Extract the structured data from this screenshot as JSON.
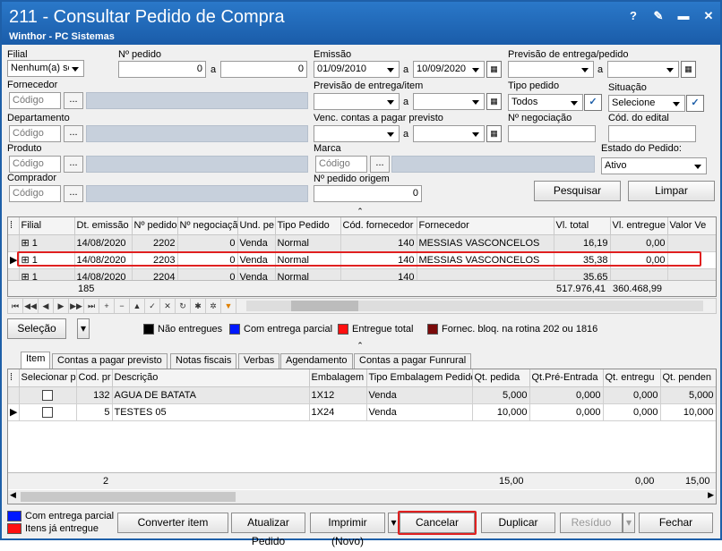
{
  "window": {
    "title": "211 - Consultar Pedido de Compra",
    "subtitle": "Winthor - PC Sistemas",
    "btn_help": "?",
    "btn_edit": "✎",
    "btn_min": "▬",
    "btn_close": "✕"
  },
  "filters": {
    "filial_label": "Filial",
    "filial_value": "Nenhum(a) se",
    "nped_label": "Nº pedido",
    "nped_from": "0",
    "nped_to": "0",
    "a": "a",
    "emissao_label": "Emissão",
    "emissao_from": "01/09/2010",
    "emissao_to": "10/09/2020",
    "prev_entrega_pedido_label": "Previsão de entrega/pedido",
    "fornecedor_label": "Fornecedor",
    "codigo_ph": "Código",
    "dots": "...",
    "prev_entrega_item_label": "Previsão de entrega/item",
    "tipo_pedido_label": "Tipo pedido",
    "tipo_pedido_value": "Todos",
    "situacao_label": "Situação",
    "situacao_value": "Selecione",
    "departamento_label": "Departamento",
    "venc_label": "Venc. contas a  pagar previsto",
    "nneg_label": "Nº negociação",
    "cod_edital_label": "Cód. do edital",
    "produto_label": "Produto",
    "marca_label": "Marca",
    "estado_label": "Estado do Pedido:",
    "estado_value": "Ativo",
    "comprador_label": "Comprador",
    "nped_origem_label": "Nº pedido origem",
    "nped_origem_value": "0",
    "pesquisar": "Pesquisar",
    "limpar": "Limpar"
  },
  "orders": {
    "headers": [
      "Filial",
      "Dt. emissão",
      "Nº pedido",
      "Nº negociaçã",
      "Und. pe",
      "Tipo Pedido",
      "Cód. fornecedor",
      "Fornecedor",
      "Vl. total",
      "Vl. entregue",
      "Valor Ve"
    ],
    "rows": [
      [
        "1",
        "14/08/2020",
        "2202",
        "0",
        "Venda",
        "Normal",
        "140",
        "MESSIAS VASCONCELOS",
        "16,19",
        "0,00",
        ""
      ],
      [
        "1",
        "14/08/2020",
        "2203",
        "0",
        "Venda",
        "Normal",
        "140",
        "MESSIAS VASCONCELOS",
        "35,38",
        "0,00",
        ""
      ],
      [
        "1",
        "14/08/2020",
        "2204",
        "0",
        "Venda",
        "Normal",
        "140",
        "",
        "35,65",
        "",
        ""
      ]
    ],
    "footer_count": "185",
    "footer_total": "517.976,41",
    "footer_entregue": "360.468,99"
  },
  "selecao": "Seleção",
  "legend": [
    {
      "label": "Não entregues",
      "color": "#000000"
    },
    {
      "label": "Com entrega parcial",
      "color": "#0018ff"
    },
    {
      "label": "Entregue total",
      "color": "#ff1010"
    },
    {
      "label": "Fornec. bloq. na rotina 202 ou 1816",
      "color": "#7a0a0a"
    }
  ],
  "tabs": [
    "Item",
    "Contas a pagar previsto",
    "Notas fiscais",
    "Verbas",
    "Agendamento",
    "Contas a pagar Funrural"
  ],
  "items": {
    "headers": [
      "Selecionar p",
      "Cod. pr",
      "Descrição",
      "Embalagem",
      "Tipo Embalagem Pedido",
      "Qt. pedida",
      "Qt.Pré-Entrada",
      "Qt. entregu",
      "Qt. penden"
    ],
    "rows": [
      [
        "",
        "132",
        "AGUA DE BATATA",
        "1X12",
        "Venda",
        "5,000",
        "0,000",
        "0,000",
        "5,000"
      ],
      [
        "",
        "5",
        "TESTES 05",
        "1X24",
        "Venda",
        "10,000",
        "0,000",
        "0,000",
        "10,000"
      ]
    ],
    "footer_count": "2",
    "footer_pedida": "15,00",
    "footer_entregue": "0,00",
    "footer_pendente": "15,00"
  },
  "bottom": {
    "legend1": "Com entrega parcial",
    "legend1_color": "#0018ff",
    "legend2": "Itens já entregue",
    "legend2_color": "#ff1010",
    "converter": "Converter item",
    "atualizar": "Atualizar Pedido",
    "imprimir": "Imprimir (Novo)",
    "cancelar": "Cancelar",
    "duplicar": "Duplicar",
    "residuo": "Resíduo",
    "fechar": "Fechar"
  }
}
